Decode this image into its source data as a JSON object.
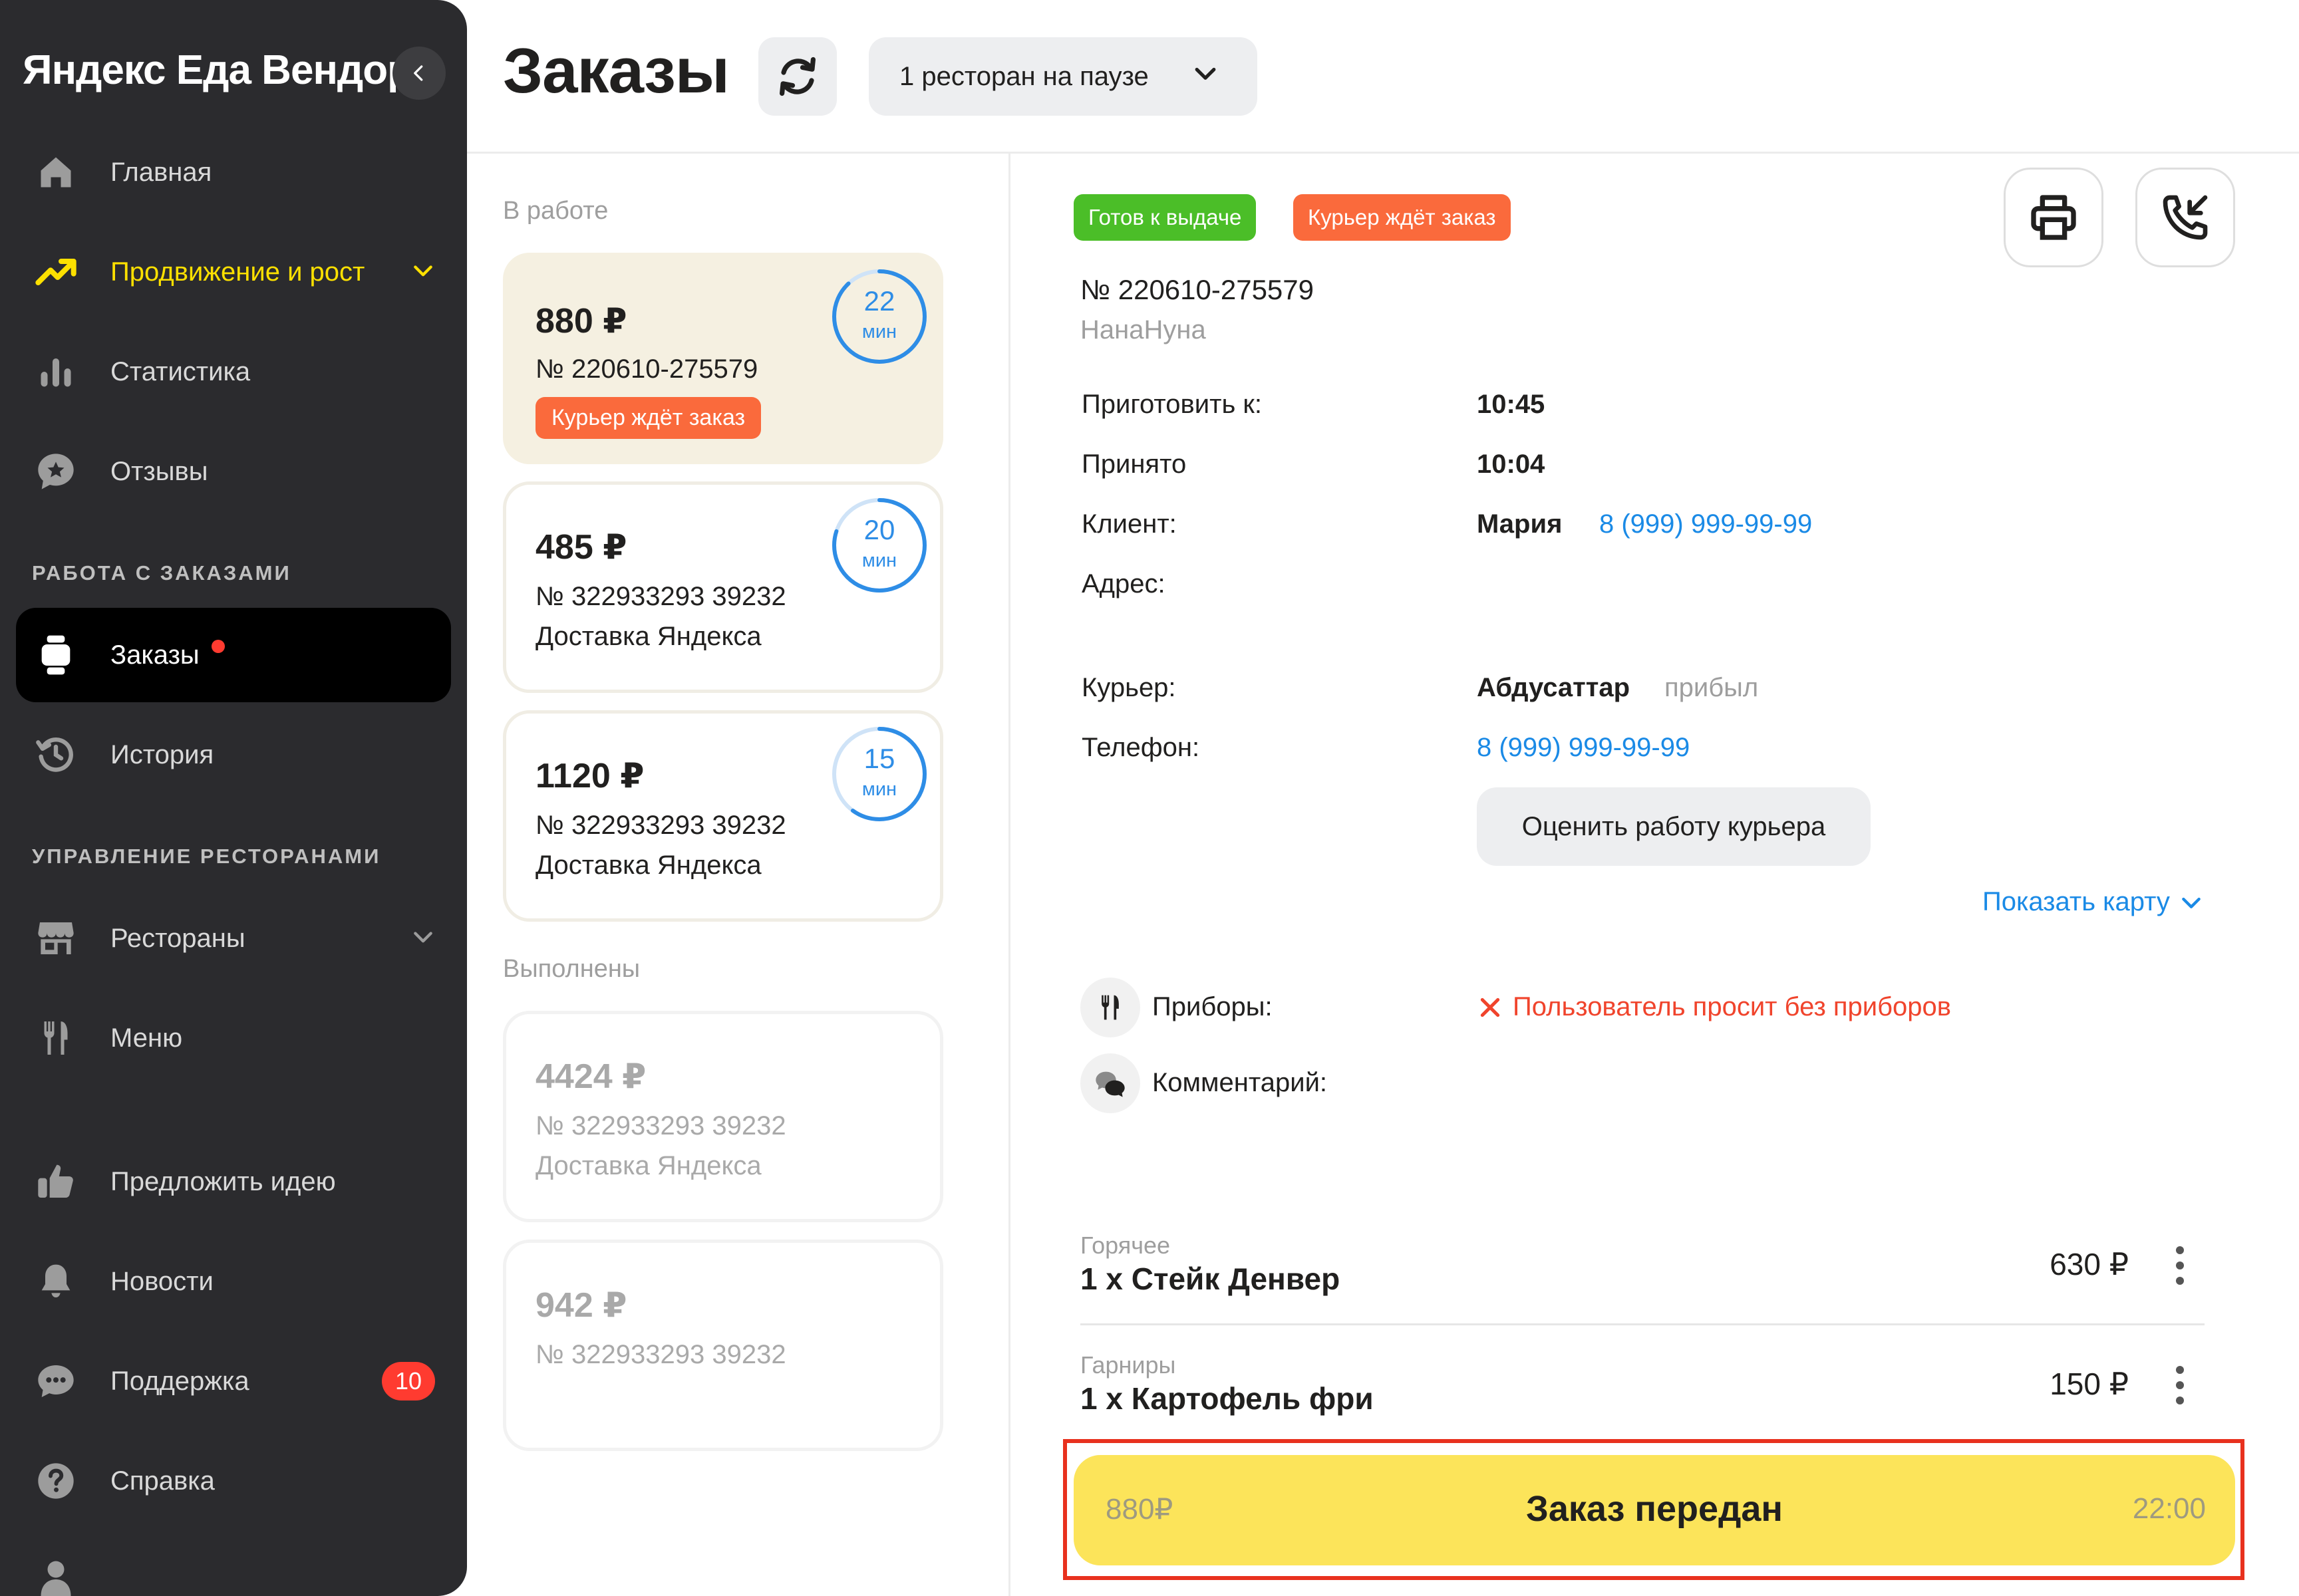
{
  "app": {
    "brand": "Яндекс Еда Вендор"
  },
  "sidebar": {
    "items": [
      {
        "label": "Главная",
        "icon": "home-icon"
      },
      {
        "label": "Продвижение и рост",
        "icon": "trend-up-icon"
      },
      {
        "label": "Статистика",
        "icon": "bar-chart-icon"
      },
      {
        "label": "Отзывы",
        "icon": "review-star-icon"
      },
      {
        "label": "Заказы",
        "icon": "orders-icon"
      },
      {
        "label": "История",
        "icon": "history-icon"
      },
      {
        "label": "Рестораны",
        "icon": "store-icon"
      },
      {
        "label": "Меню",
        "icon": "cutlery-icon"
      },
      {
        "label": "Предложить идею",
        "icon": "thumbs-up-icon"
      },
      {
        "label": "Новости",
        "icon": "bell-icon"
      },
      {
        "label": "Поддержка",
        "icon": "chat-icon",
        "badge": "10"
      },
      {
        "label": "Справка",
        "icon": "question-icon"
      }
    ],
    "sections": {
      "orders": "РАБОТА С ЗАКАЗАМИ",
      "restaurants": "УПРАВЛЕНИЕ РЕСТОРАНАМИ"
    }
  },
  "header": {
    "title": "Заказы",
    "pause_select": "1 ресторан на паузе"
  },
  "orders": {
    "in_progress_label": "В работе",
    "done_label": "Выполнены",
    "active": [
      {
        "price": "880 ₽",
        "number": "№ 220610-275579",
        "tag": "Курьер ждёт заказ",
        "timer": "22",
        "timer_unit": "мин"
      },
      {
        "price": "485 ₽",
        "number": "№ 322933293  39232",
        "delivery": "Доставка Яндекса",
        "timer": "20",
        "timer_unit": "мин"
      },
      {
        "price": "1120 ₽",
        "number": "№ 322933293  39232",
        "delivery": "Доставка Яндекса",
        "timer": "15",
        "timer_unit": "мин"
      }
    ],
    "done": [
      {
        "price": "4424 ₽",
        "number": "№ 322933293  39232",
        "delivery": "Доставка Яндекса"
      },
      {
        "price": "942 ₽",
        "number": "№ 322933293  39232"
      }
    ]
  },
  "detail": {
    "status_ready": "Готов к выдаче",
    "status_courier": "Курьер ждёт заказ",
    "number": "№ 220610-275579",
    "restaurant": "НанаНуна",
    "labels": {
      "cook_by": "Приготовить к:",
      "accepted": "Принято",
      "client": "Клиент:",
      "address": "Адрес:",
      "courier": "Курьер:",
      "phone": "Телефон:",
      "cutlery": "Приборы:",
      "comment": "Комментарий:"
    },
    "cook_by": "10:45",
    "accepted": "10:04",
    "client_name": "Мария",
    "client_phone": "8 (999) 999-99-99",
    "courier_name": "Абдусаттар",
    "courier_status": "прибыл",
    "courier_phone": "8 (999) 999-99-99",
    "rate_courier": "Оценить работу курьера",
    "show_map": "Показать карту",
    "cutlery_value": "Пользователь просит без приборов",
    "items": [
      {
        "category": "Горячее",
        "name": "1 x Стейк Денвер",
        "price": "630 ₽"
      },
      {
        "category": "Гарниры",
        "name": "1 x Картофель фри",
        "price": "150 ₽"
      }
    ],
    "bottom": {
      "total": "880₽",
      "label": "Заказ передан",
      "time": "22:00"
    }
  },
  "colors": {
    "accent_yellow": "#fce000",
    "tag_orange": "#fa6a3c",
    "tag_green": "#4bbe28",
    "link_blue": "#1a8ae6",
    "warn_red": "#f0442c"
  }
}
